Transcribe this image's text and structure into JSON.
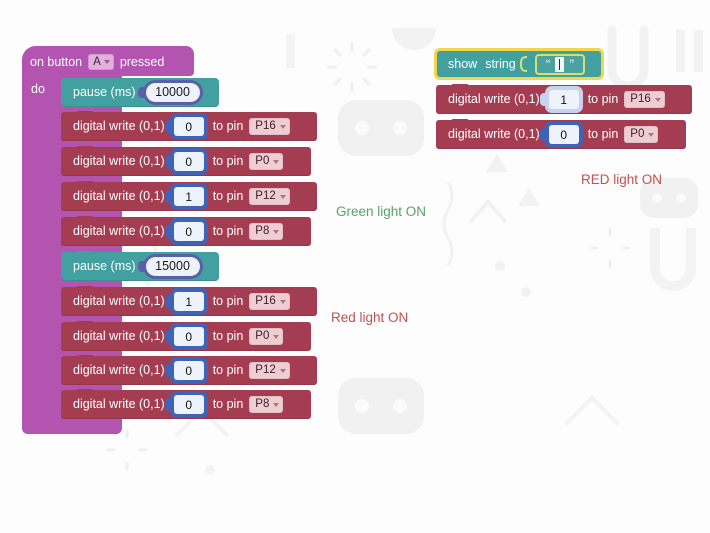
{
  "canvas": {
    "background_color": "#fdfdfd",
    "watermark": [
      "robot-face",
      "sun-rays",
      "letter-u",
      "magnet",
      "squiggle",
      "sparkle",
      "chevron"
    ]
  },
  "left_program": {
    "event_block": {
      "label_before": "on button",
      "selector_value": "A",
      "label_after": "pressed",
      "body_label": "do",
      "color": "#b254b0"
    },
    "statements": [
      {
        "kind": "pause",
        "label": "pause (ms)",
        "value": "10000",
        "color": "#43a0a0"
      },
      {
        "kind": "dwrite",
        "label": "digital write (0,1)",
        "value": "0",
        "to_pin_label": "to pin",
        "pin": "P16",
        "color": "#a53d52"
      },
      {
        "kind": "dwrite",
        "label": "digital write (0,1)",
        "value": "0",
        "to_pin_label": "to pin",
        "pin": "P0",
        "color": "#a53d52"
      },
      {
        "kind": "dwrite",
        "label": "digital write (0,1)",
        "value": "1",
        "to_pin_label": "to pin",
        "pin": "P12",
        "color": "#a53d52"
      },
      {
        "kind": "dwrite",
        "label": "digital write (0,1)",
        "value": "0",
        "to_pin_label": "to pin",
        "pin": "P8",
        "color": "#a53d52"
      },
      {
        "kind": "pause",
        "label": "pause (ms)",
        "value": "15000",
        "color": "#43a0a0"
      },
      {
        "kind": "dwrite",
        "label": "digital write (0,1)",
        "value": "1",
        "to_pin_label": "to pin",
        "pin": "P16",
        "color": "#a53d52"
      },
      {
        "kind": "dwrite",
        "label": "digital write (0,1)",
        "value": "0",
        "to_pin_label": "to pin",
        "pin": "P0",
        "color": "#a53d52"
      },
      {
        "kind": "dwrite",
        "label": "digital write (0,1)",
        "value": "0",
        "to_pin_label": "to pin",
        "pin": "P12",
        "color": "#a53d52"
      },
      {
        "kind": "dwrite",
        "label": "digital write (0,1)",
        "value": "0",
        "to_pin_label": "to pin",
        "pin": "P8",
        "color": "#a53d52"
      }
    ]
  },
  "right_program": {
    "show_string": {
      "label_1": "show",
      "label_2": "string",
      "value": "",
      "open_quote": "“",
      "close_quote": "”",
      "selected": true,
      "highlight_color": "#f0d64a",
      "color": "#43a0a0"
    },
    "statements": [
      {
        "kind": "dwrite",
        "label": "digital write (0,1)",
        "value": "1",
        "to_pin_label": "to pin",
        "pin": "P16",
        "color": "#a53d52",
        "field_style": "light"
      },
      {
        "kind": "dwrite",
        "label": "digital write (0,1)",
        "value": "0",
        "to_pin_label": "to pin",
        "pin": "P0",
        "color": "#a53d52",
        "field_style": "normal"
      }
    ]
  },
  "annotations": [
    {
      "text": "RED light ON",
      "color": "#c0514f"
    },
    {
      "text": "Green light ON",
      "color": "#5aa06a"
    },
    {
      "text": "Red light ON",
      "color": "#c0514f"
    }
  ]
}
